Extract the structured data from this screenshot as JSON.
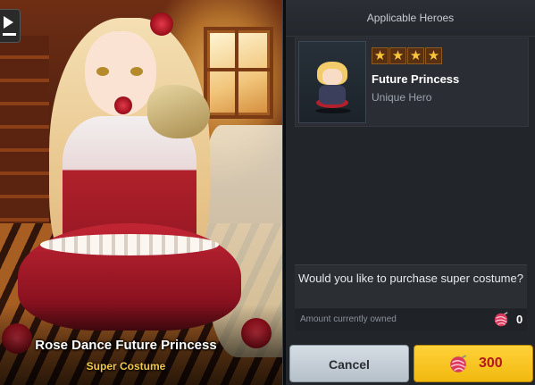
{
  "costume": {
    "name": "Rose Dance Future Princess",
    "type": "Super Costume"
  },
  "panel": {
    "title": "Applicable Heroes",
    "hero": {
      "stars": 4,
      "name": "Future Princess",
      "class": "Unique Hero"
    },
    "confirm_text": "Would you like to purchase super costume?",
    "owned_label": "Amount currently owned",
    "owned_value": "0"
  },
  "buttons": {
    "cancel_label": "Cancel",
    "buy_price": "300"
  },
  "icons": {
    "back": "back-play-icon",
    "currency": "yarn-ball-icon",
    "star": "star-icon"
  },
  "colors": {
    "accent_gold": "#f3c74a",
    "buy_button": "#f7c427",
    "price_red": "#b3171c"
  }
}
